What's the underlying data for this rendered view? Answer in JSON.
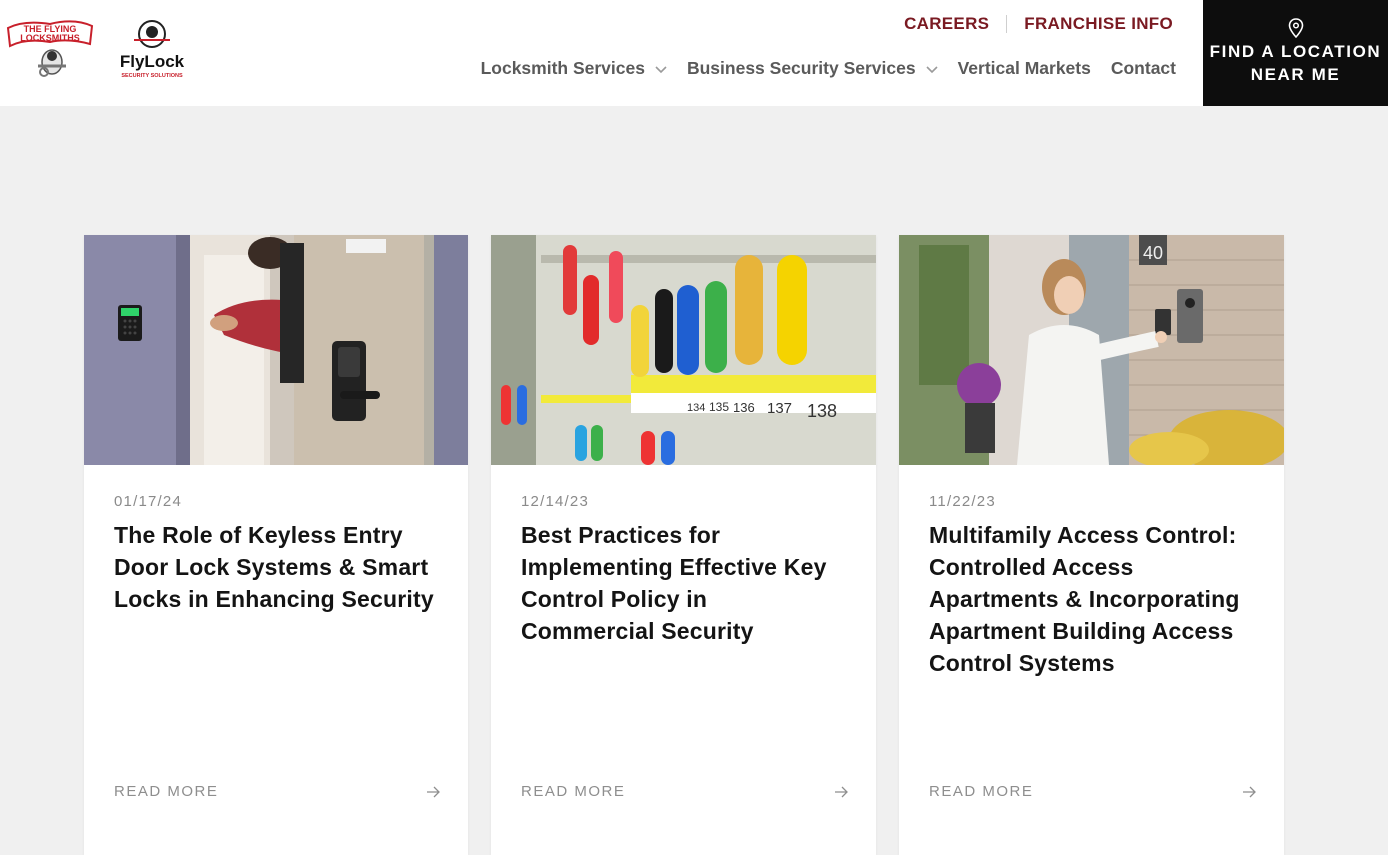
{
  "header": {
    "top_links": [
      "CAREERS",
      "FRANCHISE INFO"
    ],
    "nav": [
      {
        "label": "Locksmith Services",
        "has_dropdown": true
      },
      {
        "label": "Business Security Services",
        "has_dropdown": true
      },
      {
        "label": "Vertical Markets",
        "has_dropdown": false
      },
      {
        "label": "Contact",
        "has_dropdown": false
      }
    ],
    "cta": {
      "line1": "FIND A LOCATION",
      "line2": "NEAR ME",
      "icon": "map-pin-icon"
    },
    "logos": {
      "flying_locksmiths": [
        "THE FLYING",
        "LOCKSMITHS"
      ],
      "flylock": "FlyLock",
      "flylock_tagline": "SECURITY SOLUTIONS"
    }
  },
  "colors": {
    "accent": "#7a1a22",
    "cta_bg": "#0d0d0d",
    "page_bg": "#f0f0f0"
  },
  "cards": [
    {
      "date": "01/17/24",
      "title": "The Role of Keyless Entry Door Lock Systems & Smart Locks in Enhancing Security",
      "read_more": "READ MORE",
      "image": "keyless-door-lock-photo"
    },
    {
      "date": "12/14/23",
      "title": "Best Practices for Implementing Effective Key Control Policy in Commercial Security",
      "read_more": "READ MORE",
      "image": "key-cabinet-photo",
      "image_tag_numbers": [
        "134",
        "135",
        "136",
        "137",
        "138"
      ]
    },
    {
      "date": "11/22/23",
      "title": "Multifamily Access Control: Controlled Access Apartments & Incorporating Apartment Building Access Control Systems",
      "read_more": "READ MORE",
      "image": "access-control-photo",
      "image_building_number": "40"
    }
  ]
}
